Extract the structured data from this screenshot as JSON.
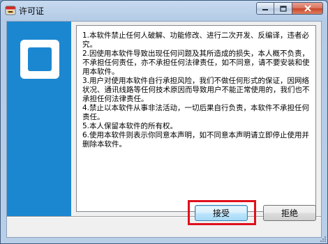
{
  "window": {
    "title": "许可证"
  },
  "license": {
    "paragraphs": [
      "1.本软件禁止任何人破解、功能修改、进行二次开发、反编译，违者必究。",
      "2.因使用本软件导致出现任何问题及其所造成的损失，本人概不负责，不承担任何责任，亦不承担任何法律责任，如不同意，请不要安装和使用本软件。",
      "3.用户对使用本软件自行承担风险，我们不做任何形式的保证，因网络状况、通讯线路等任何技术原因而导致用户不能正常使用的，我们也不承担任何法律责任。",
      "4.禁止以本软件从事非法活动，一切后果自行负责，本软件不承担任何责任。",
      "5.本人保留本软件的所有权。",
      "6.使用本软件则表示你同意本声明，如不同意本声明请立即停止使用并删除本软件。"
    ]
  },
  "buttons": {
    "accept_label": "接受",
    "decline_label": "拒绝"
  },
  "colors": {
    "side_panel": "#1c87d1",
    "highlight": "#e0101c"
  }
}
